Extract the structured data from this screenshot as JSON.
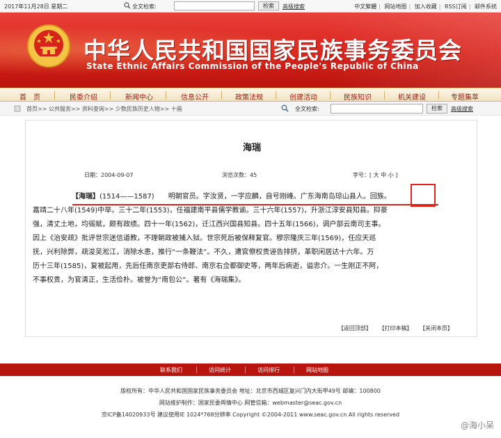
{
  "topbar": {
    "date": "2017年11月28日 星期二",
    "search_label": "全文检索:",
    "search_button": "检索",
    "advanced": "高级搜索",
    "links": [
      "中文繁體",
      "网站地图",
      "加入收藏",
      "RSS订阅",
      "邮件系统"
    ]
  },
  "header": {
    "title_cn": "中华人民共和国国家民族事务委员会",
    "title_en": "State Ethnic Affairs Commission of the People's Republic of China"
  },
  "nav": {
    "items": [
      "首　页",
      "民委介绍",
      "新闻中心",
      "信息公开",
      "政策法规",
      "创建活动",
      "民族知识",
      "机关建设",
      "专题集萃"
    ]
  },
  "breadcrumb": {
    "path": "首页>> 公共服务>> 资料查询>> 少数民族历史人物>> 十画",
    "search_label": "全文检索:",
    "search_button": "检索",
    "advanced": "高级搜索"
  },
  "article": {
    "title": "海瑞",
    "date": "日期：2004-09-07",
    "views": "浏览次数：45",
    "fontsize": "字号：[ 大 中 小 ]",
    "name": "【海瑞】",
    "line1_rest": "(1514——1587)　　明朝官员。字汝贤，一字应麟，自号刚峰。广东海南岛琼山县人。回族。",
    "lines": [
      "嘉靖二十八年(1549)中举。三十二年(1553)，任福建南平县儒学教谕。三十六年(1557)，升浙江淳安县知县。抑豪",
      "强，清丈土地，均徭赋，颇有政绩。四十一年(1562)，迁江西兴国县知县。四十五年(1566)，调户部云南司主事。",
      "因上《治安疏》批评世宗迷信道教，不理朝政被捕入狱。世宗死后被保释复官。穆宗隆庆三年(1569)，任应天巡",
      "抚，兴利除弊，疏浚吴淞江，消除水患，推行“一条鞭法”。不久，遭官僚权贵诬告排挤，革职闲居达十六年。万",
      "历十三年(1585)，复被起用，先后任南京吏部右侍郎、南京右佥都御史等，两年后病逝，谥忠介。一生刚正不阿，",
      "不事权贵，为官清正，生活俭朴。被誉为“南包公”。著有《海瑞集》。"
    ],
    "actions": [
      "【返回顶部】",
      "【打印本稿】",
      "【关闭本页】"
    ]
  },
  "footer": {
    "links": [
      "联系我们",
      "访问统计",
      "访问排行",
      "网站地图"
    ],
    "info": [
      "版权所有：中华人民共和国国家民族事务委员会  地址：北京市西城区复兴门内大街甲49号  邮编：100800",
      "网站维护制作：国家民委舆情中心  网管信箱：webmaster@seac.gov.cn",
      "京ICP备14020933号  建议使用IE 1024*768分辨率  Copyright ©2004-2011 www.seac.gov.cn All rights reserved"
    ]
  },
  "watermark": "@海小呆"
}
